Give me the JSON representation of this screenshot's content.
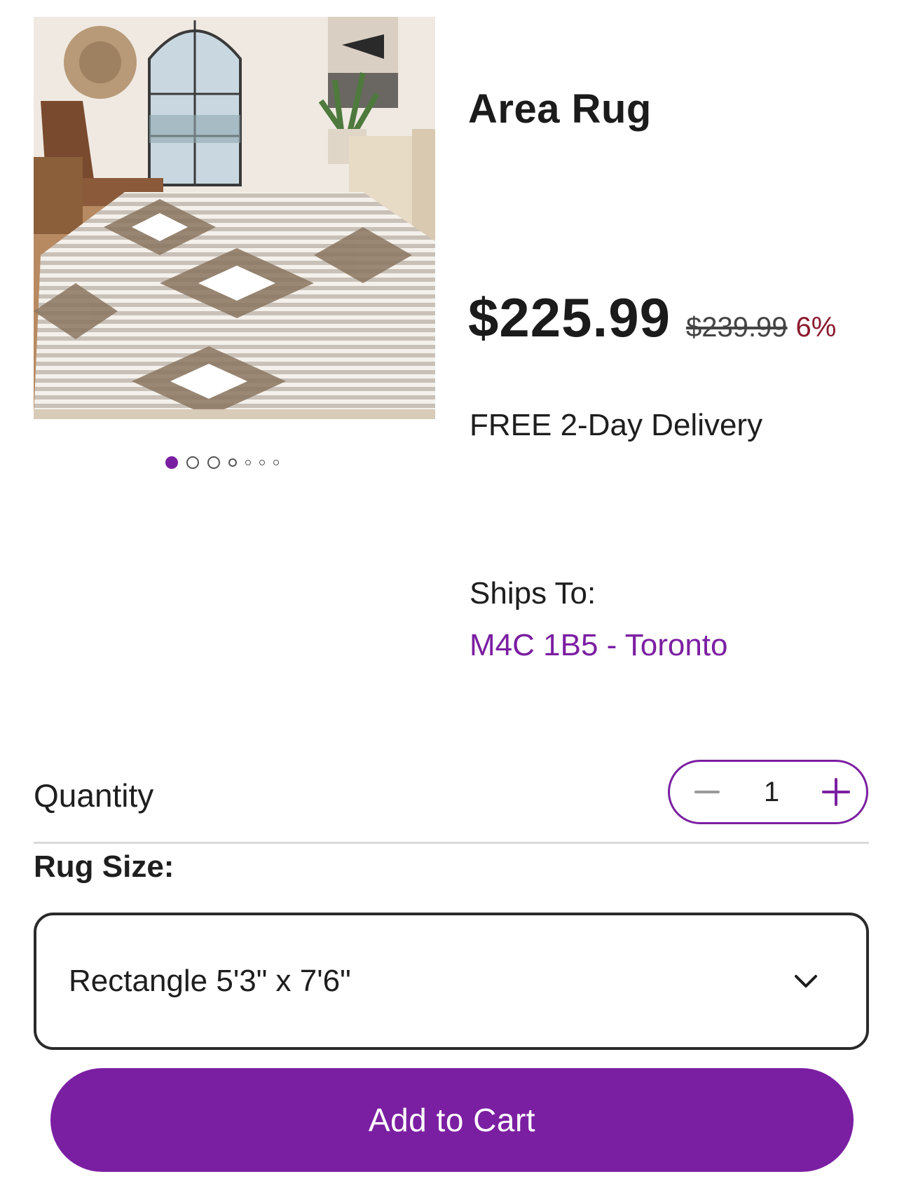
{
  "product": {
    "title": "Area Rug",
    "image_alt": "Area rug in a living room",
    "price": "$225.99",
    "was_price": "$239.99",
    "discount": "6%"
  },
  "carousel": {
    "count": 7,
    "active_index": 0
  },
  "shipping": {
    "delivery": "FREE 2-Day Delivery",
    "ships_to_label": "Ships To:",
    "location": "M4C 1B5 - Toronto"
  },
  "quantity": {
    "label": "Quantity",
    "value": "1"
  },
  "rug_size": {
    "label": "Rug Size:",
    "selected": "Rectangle 5'3\" x 7'6\""
  },
  "actions": {
    "add_to_cart": "Add to Cart"
  },
  "icons": {
    "decrease": "minus-icon",
    "increase": "plus-icon",
    "dropdown": "chevron-down-icon"
  },
  "colors": {
    "accent": "#7b1fa2",
    "discount": "#8b1a2e"
  }
}
